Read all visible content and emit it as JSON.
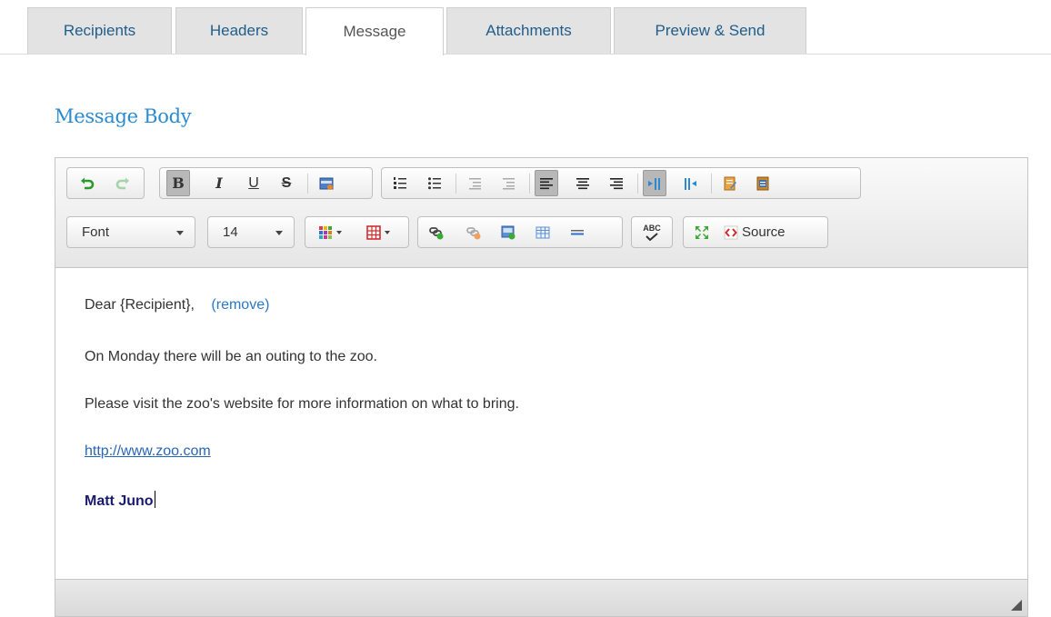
{
  "tabs": [
    {
      "label": "Recipients",
      "active": false
    },
    {
      "label": "Headers",
      "active": false
    },
    {
      "label": "Message",
      "active": true
    },
    {
      "label": "Attachments",
      "active": false
    },
    {
      "label": "Preview & Send",
      "active": false
    }
  ],
  "section_title": "Message Body",
  "toolbar": {
    "font_select": "Font",
    "size_select": "14",
    "source_label": "Source",
    "spellcheck_glyph": "ABC"
  },
  "message": {
    "greeting": "Dear {Recipient},",
    "remove_label": "(remove)",
    "line1": "On Monday there will be an outing to the zoo.",
    "line2": "Please visit the zoo's website for more information on what to bring.",
    "link": "http://www.zoo.com",
    "signature": "Matt Juno"
  },
  "colors": {
    "accent": "#2a8bd0",
    "link": "#2a66b8",
    "signature": "#1a1a6e"
  }
}
